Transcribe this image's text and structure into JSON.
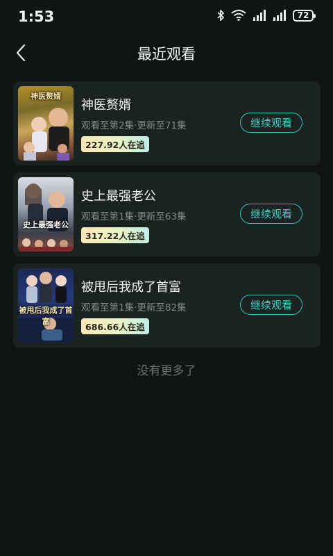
{
  "status_bar": {
    "time": "1:53",
    "battery": "72",
    "icons": [
      "bluetooth-icon",
      "wifi-icon",
      "signal-icon",
      "signal-icon",
      "battery-icon"
    ]
  },
  "header": {
    "title": "最近观看",
    "back_icon": "back-arrow-icon"
  },
  "items": [
    {
      "title": "神医赘婿",
      "progress": "观看至第2集·更新至71集",
      "followers": "227.92人在追",
      "button": "继续观看",
      "cover_text": "神医赘婿"
    },
    {
      "title": "史上最强老公",
      "progress": "观看至第1集·更新至63集",
      "followers": "317.22人在追",
      "button": "继续观看",
      "cover_text": "史上最强老公"
    },
    {
      "title": "被甩后我成了首富",
      "progress": "观看至第1集·更新至82集",
      "followers": "686.66人在追",
      "button": "继续观看",
      "cover_text": "被甩后我成了首富"
    }
  ],
  "footer": {
    "no_more": "没有更多了"
  },
  "colors": {
    "background": "#0f1513",
    "card": "#1b2321",
    "accent": "#2fc3ba"
  }
}
